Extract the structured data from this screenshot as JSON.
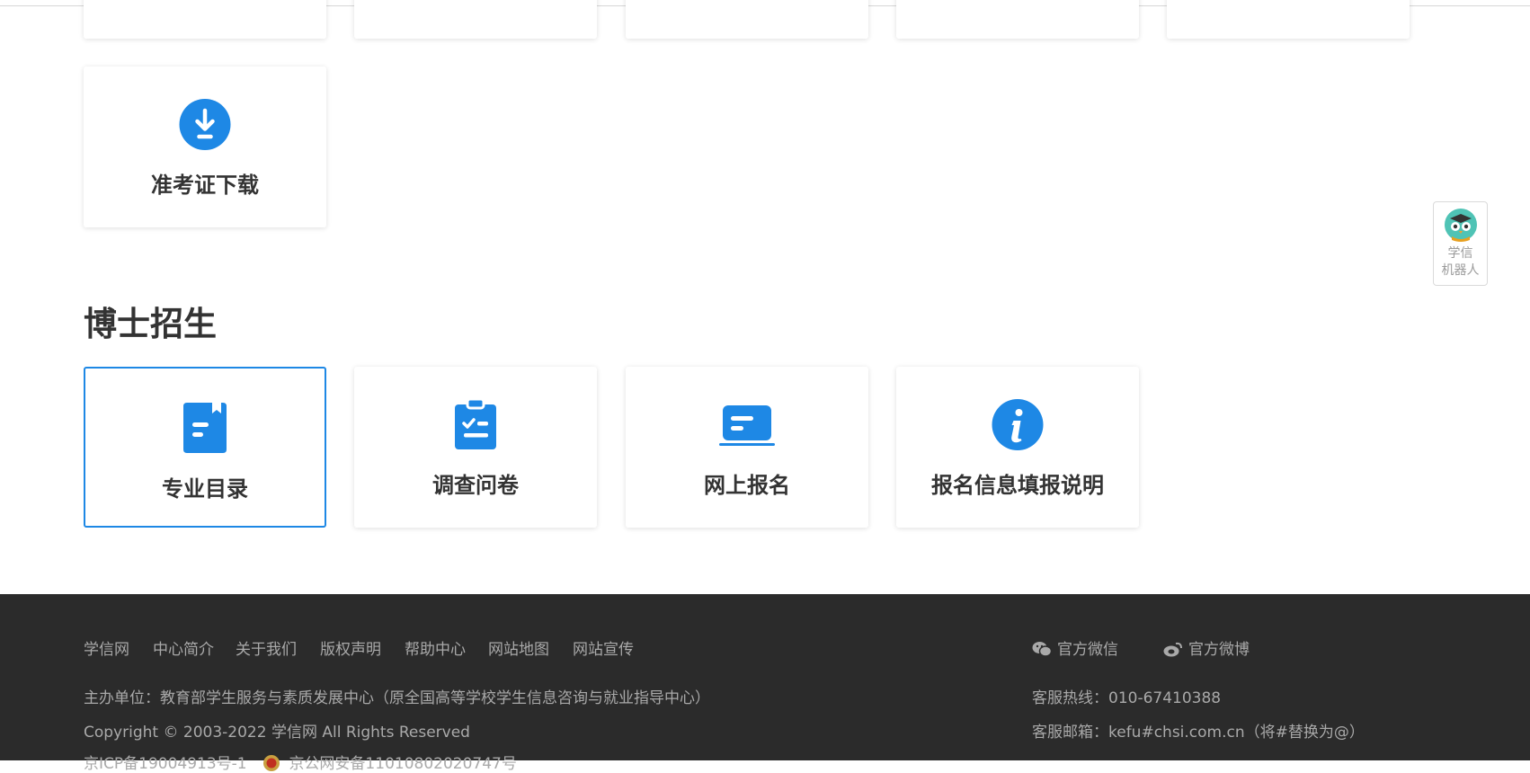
{
  "top_cards_partial": [
    "",
    "",
    "",
    "",
    ""
  ],
  "prev_section": {
    "cards": [
      {
        "label": "准考证下载",
        "icon": "download-icon"
      }
    ]
  },
  "doctoral": {
    "title": "博士招生",
    "cards": [
      {
        "label": "专业目录",
        "icon": "bookmark-doc-icon",
        "selected": true
      },
      {
        "label": "调查问卷",
        "icon": "clipboard-check-icon"
      },
      {
        "label": "网上报名",
        "icon": "laptop-form-icon"
      },
      {
        "label": "报名信息填报说明",
        "icon": "info-icon"
      }
    ]
  },
  "robot": {
    "line1": "学信",
    "line2": "机器人"
  },
  "footer": {
    "links": [
      "学信网",
      "中心简介",
      "关于我们",
      "版权声明",
      "帮助中心",
      "网站地图",
      "网站宣传"
    ],
    "social": {
      "wechat": "官方微信",
      "weibo": "官方微博"
    },
    "sponsor": "主办单位：教育部学生服务与素质发展中心（原全国高等学校学生信息咨询与就业指导中心）",
    "copyright": "Copyright © 2003-2022 学信网 All Rights Reserved",
    "icp": "京ICP备19004913号-1",
    "police": "京公网安备11010802020747号",
    "hotline": "客服热线：010-67410388",
    "email": "客服邮箱：kefu#chsi.com.cn（将#替换为@）"
  },
  "colors": {
    "accent": "#1e88e5",
    "footer_bg": "#2b2b2b",
    "footer_text": "#a9a9a9"
  }
}
